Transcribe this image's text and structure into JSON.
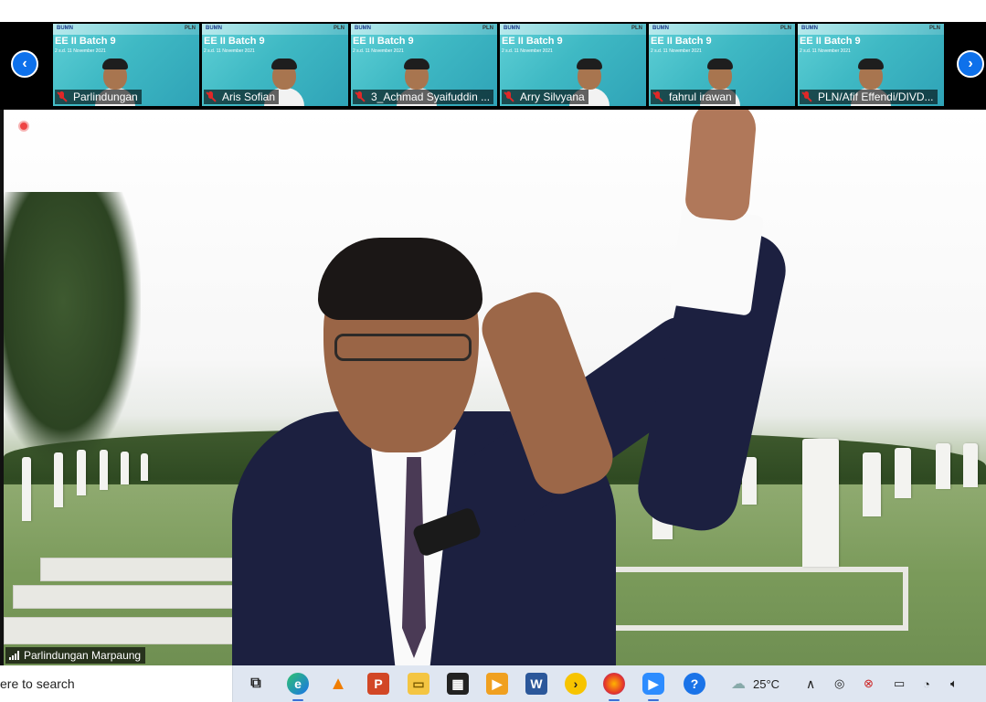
{
  "gallery": {
    "nav_prev_icon": "chevron-left-icon",
    "nav_next_icon": "chevron-right-icon",
    "thumbnails": [
      {
        "name": "Parlindungan",
        "batch": "EE II Batch 9",
        "dates": "2 s.d. 11 November 2021",
        "logo_left": "BUMN",
        "logo_right": "PLN",
        "muted": true
      },
      {
        "name": "Aris Sofian",
        "batch": "EE II Batch 9",
        "dates": "2 s.d. 11 November 2021",
        "logo_left": "BUMN",
        "logo_right": "PLN",
        "muted": true
      },
      {
        "name": "3_Achmad Syaifuddin ...",
        "batch": "EE II Batch 9",
        "dates": "2 s.d. 11 November 2021",
        "logo_left": "BUMN",
        "logo_right": "PLN",
        "muted": true
      },
      {
        "name": "Arry Silvyana",
        "batch": "EE II Batch 9",
        "dates": "2 s.d. 11 November 2021",
        "logo_left": "BUMN",
        "logo_right": "PLN",
        "muted": true
      },
      {
        "name": "fahrul irawan",
        "batch": "EE II Batch 9",
        "dates": "2 s.d. 11 November 2021",
        "logo_left": "BUMN",
        "logo_right": "PLN",
        "muted": true
      },
      {
        "name": "PLN/Afif Effendi/DIVD...",
        "batch": "EE II Batch 9",
        "dates": "2 s.d. 11 November 2021",
        "logo_left": "BUMN",
        "logo_right": "PLN",
        "muted": true
      }
    ]
  },
  "main_video": {
    "speaker_name": "Parlindungan Marpaung",
    "recording_indicator": "record-dot-icon"
  },
  "taskbar": {
    "search_text": "ere to search",
    "apps": [
      "task-view-icon",
      "edge-icon",
      "vlc-icon",
      "powerpoint-icon",
      "file-explorer-icon",
      "store-icon",
      "media-player-icon",
      "word-icon",
      "plex-icon",
      "firefox-icon",
      "zoom-icon",
      "help-icon"
    ],
    "weather_temp": "25°C",
    "tray_icons": [
      "chevron-up-icon",
      "meet-now-icon",
      "network-warning-icon",
      "battery-icon",
      "wifi-icon",
      "volume-icon"
    ]
  },
  "colors": {
    "zoom_blue": "#0e71eb",
    "taskbar_bg": "#dfe6f1",
    "muted_red": "#e02828"
  }
}
